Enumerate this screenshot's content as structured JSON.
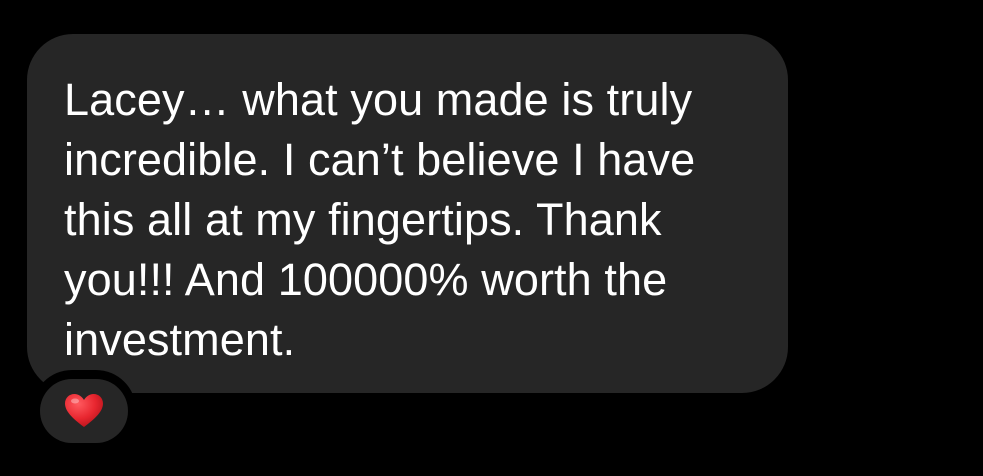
{
  "message": {
    "text": "Lacey… what you made is truly\nincredible. I can’t believe I have\nthis all at my fingertips. Thank\nyou!!! And 100000% worth the\ninvestment."
  },
  "reaction": {
    "icon": "red-heart-icon",
    "color": "#e8262f"
  },
  "colors": {
    "background": "#000000",
    "bubble": "#262626",
    "text": "#ffffff"
  }
}
